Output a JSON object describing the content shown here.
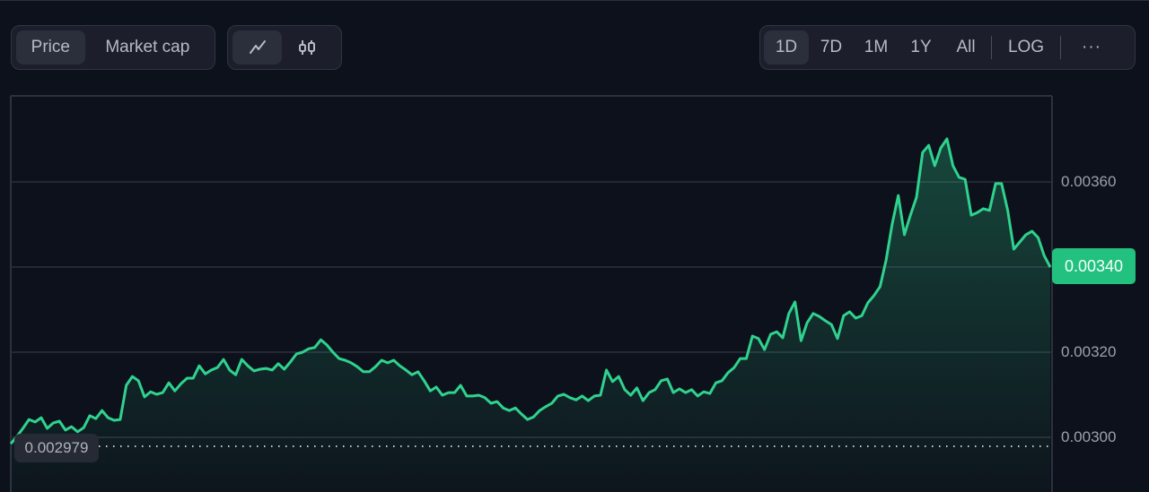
{
  "toolbar": {
    "data_type_tabs": [
      {
        "label": "Price",
        "active": true
      },
      {
        "label": "Market cap",
        "active": false
      }
    ],
    "view_tabs": [
      {
        "icon": "line-chart-icon",
        "active": true
      },
      {
        "icon": "candlestick-icon",
        "active": false
      }
    ],
    "range_tabs": [
      {
        "label": "1D",
        "active": true
      },
      {
        "label": "7D",
        "active": false
      },
      {
        "label": "1M",
        "active": false
      },
      {
        "label": "1Y",
        "active": false
      },
      {
        "label": "All",
        "active": false
      }
    ],
    "log_label": "LOG",
    "more_label": "···"
  },
  "colors": {
    "background": "#0d111b",
    "line": "#2fd28e",
    "accent": "#22c17f",
    "grid": "#2c313d"
  },
  "chart_data": {
    "type": "area",
    "title": "",
    "xlabel": "",
    "ylabel": "",
    "range": "1D",
    "ylim": [
      0.002985,
      0.003808
    ],
    "y_ticks": [
      "0.00300",
      "0.00320",
      "0.00340",
      "0.00360"
    ],
    "y_tick_values": [
      0.003,
      0.0032,
      0.0034,
      0.0036
    ],
    "grid": true,
    "current_price": "0.00340",
    "open_price": "0.002979",
    "series": [
      {
        "name": "Price",
        "values": [
          0.002985,
          0.003002,
          0.003021,
          0.003042,
          0.003036,
          0.003046,
          0.003021,
          0.003034,
          0.003038,
          0.003017,
          0.003025,
          0.003013,
          0.003023,
          0.003051,
          0.003044,
          0.003063,
          0.003046,
          0.00304,
          0.003042,
          0.003122,
          0.003143,
          0.003133,
          0.003095,
          0.003107,
          0.003101,
          0.003105,
          0.003128,
          0.003109,
          0.003126,
          0.003139,
          0.003139,
          0.003168,
          0.003149,
          0.003158,
          0.003164,
          0.003183,
          0.003158,
          0.003147,
          0.003183,
          0.003168,
          0.003156,
          0.00316,
          0.003162,
          0.003158,
          0.003173,
          0.00316,
          0.003177,
          0.003196,
          0.0032,
          0.003208,
          0.003211,
          0.003229,
          0.003217,
          0.0032,
          0.003185,
          0.003181,
          0.003175,
          0.003166,
          0.003154,
          0.003154,
          0.003166,
          0.003181,
          0.003175,
          0.003181,
          0.003168,
          0.003158,
          0.003147,
          0.003154,
          0.003133,
          0.003109,
          0.003118,
          0.003099,
          0.003105,
          0.003105,
          0.003122,
          0.003097,
          0.003097,
          0.003099,
          0.003093,
          0.00308,
          0.003084,
          0.003069,
          0.003063,
          0.003069,
          0.003055,
          0.003042,
          0.003048,
          0.003063,
          0.003072,
          0.00308,
          0.003097,
          0.003101,
          0.003093,
          0.003088,
          0.003097,
          0.003086,
          0.003097,
          0.003099,
          0.003158,
          0.003131,
          0.003143,
          0.003112,
          0.003099,
          0.003116,
          0.003086,
          0.003105,
          0.003112,
          0.003133,
          0.003137,
          0.003105,
          0.003114,
          0.003105,
          0.003112,
          0.003097,
          0.003107,
          0.003103,
          0.003128,
          0.003133,
          0.003152,
          0.003164,
          0.003185,
          0.003185,
          0.003238,
          0.003232,
          0.003206,
          0.003242,
          0.003248,
          0.003234,
          0.003291,
          0.003318,
          0.003227,
          0.003269,
          0.003291,
          0.003284,
          0.003274,
          0.003265,
          0.003232,
          0.003286,
          0.003295,
          0.00328,
          0.003286,
          0.003316,
          0.003333,
          0.003354,
          0.003417,
          0.003501,
          0.003568,
          0.003476,
          0.003522,
          0.003564,
          0.003669,
          0.003686,
          0.003638,
          0.00368,
          0.003701,
          0.003638,
          0.003611,
          0.003606,
          0.003522,
          0.003528,
          0.003537,
          0.003533,
          0.003596,
          0.003596,
          0.003533,
          0.003442,
          0.003459,
          0.003476,
          0.003484,
          0.003469,
          0.003427,
          0.0034
        ]
      }
    ]
  }
}
